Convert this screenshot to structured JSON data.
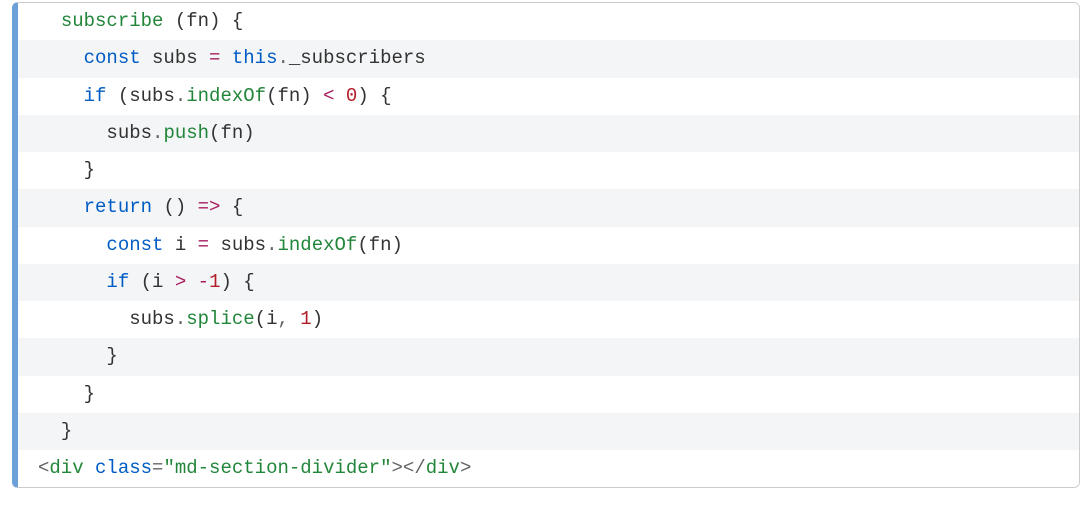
{
  "code": {
    "lines": [
      [
        {
          "cls": "tok-plain",
          "text": "  "
        },
        {
          "cls": "tok-function",
          "text": "subscribe"
        },
        {
          "cls": "tok-plain",
          "text": " "
        },
        {
          "cls": "tok-paren",
          "text": "("
        },
        {
          "cls": "tok-plain",
          "text": "fn"
        },
        {
          "cls": "tok-paren",
          "text": ")"
        },
        {
          "cls": "tok-plain",
          "text": " "
        },
        {
          "cls": "tok-paren",
          "text": "{"
        }
      ],
      [
        {
          "cls": "tok-plain",
          "text": "    "
        },
        {
          "cls": "tok-keyword",
          "text": "const"
        },
        {
          "cls": "tok-plain",
          "text": " subs "
        },
        {
          "cls": "tok-operator",
          "text": "="
        },
        {
          "cls": "tok-plain",
          "text": " "
        },
        {
          "cls": "tok-keyword",
          "text": "this"
        },
        {
          "cls": "tok-punct",
          "text": "."
        },
        {
          "cls": "tok-prop",
          "text": "_subscribers"
        }
      ],
      [
        {
          "cls": "tok-plain",
          "text": "    "
        },
        {
          "cls": "tok-keyword",
          "text": "if"
        },
        {
          "cls": "tok-plain",
          "text": " "
        },
        {
          "cls": "tok-paren",
          "text": "("
        },
        {
          "cls": "tok-plain",
          "text": "subs"
        },
        {
          "cls": "tok-punct",
          "text": "."
        },
        {
          "cls": "tok-function",
          "text": "indexOf"
        },
        {
          "cls": "tok-paren",
          "text": "("
        },
        {
          "cls": "tok-plain",
          "text": "fn"
        },
        {
          "cls": "tok-paren",
          "text": ")"
        },
        {
          "cls": "tok-plain",
          "text": " "
        },
        {
          "cls": "tok-operator",
          "text": "<"
        },
        {
          "cls": "tok-plain",
          "text": " "
        },
        {
          "cls": "tok-number",
          "text": "0"
        },
        {
          "cls": "tok-paren",
          "text": ")"
        },
        {
          "cls": "tok-plain",
          "text": " "
        },
        {
          "cls": "tok-paren",
          "text": "{"
        }
      ],
      [
        {
          "cls": "tok-plain",
          "text": "      subs"
        },
        {
          "cls": "tok-punct",
          "text": "."
        },
        {
          "cls": "tok-function",
          "text": "push"
        },
        {
          "cls": "tok-paren",
          "text": "("
        },
        {
          "cls": "tok-plain",
          "text": "fn"
        },
        {
          "cls": "tok-paren",
          "text": ")"
        }
      ],
      [
        {
          "cls": "tok-plain",
          "text": "    "
        },
        {
          "cls": "tok-paren",
          "text": "}"
        }
      ],
      [
        {
          "cls": "tok-plain",
          "text": "    "
        },
        {
          "cls": "tok-keyword",
          "text": "return"
        },
        {
          "cls": "tok-plain",
          "text": " "
        },
        {
          "cls": "tok-paren",
          "text": "("
        },
        {
          "cls": "tok-paren",
          "text": ")"
        },
        {
          "cls": "tok-plain",
          "text": " "
        },
        {
          "cls": "tok-operator",
          "text": "=>"
        },
        {
          "cls": "tok-plain",
          "text": " "
        },
        {
          "cls": "tok-paren",
          "text": "{"
        }
      ],
      [
        {
          "cls": "tok-plain",
          "text": "      "
        },
        {
          "cls": "tok-keyword",
          "text": "const"
        },
        {
          "cls": "tok-plain",
          "text": " i "
        },
        {
          "cls": "tok-operator",
          "text": "="
        },
        {
          "cls": "tok-plain",
          "text": " subs"
        },
        {
          "cls": "tok-punct",
          "text": "."
        },
        {
          "cls": "tok-function",
          "text": "indexOf"
        },
        {
          "cls": "tok-paren",
          "text": "("
        },
        {
          "cls": "tok-plain",
          "text": "fn"
        },
        {
          "cls": "tok-paren",
          "text": ")"
        }
      ],
      [
        {
          "cls": "tok-plain",
          "text": "      "
        },
        {
          "cls": "tok-keyword",
          "text": "if"
        },
        {
          "cls": "tok-plain",
          "text": " "
        },
        {
          "cls": "tok-paren",
          "text": "("
        },
        {
          "cls": "tok-plain",
          "text": "i "
        },
        {
          "cls": "tok-operator",
          "text": ">"
        },
        {
          "cls": "tok-plain",
          "text": " "
        },
        {
          "cls": "tok-operator",
          "text": "-"
        },
        {
          "cls": "tok-number",
          "text": "1"
        },
        {
          "cls": "tok-paren",
          "text": ")"
        },
        {
          "cls": "tok-plain",
          "text": " "
        },
        {
          "cls": "tok-paren",
          "text": "{"
        }
      ],
      [
        {
          "cls": "tok-plain",
          "text": "        subs"
        },
        {
          "cls": "tok-punct",
          "text": "."
        },
        {
          "cls": "tok-function",
          "text": "splice"
        },
        {
          "cls": "tok-paren",
          "text": "("
        },
        {
          "cls": "tok-plain",
          "text": "i"
        },
        {
          "cls": "tok-punct",
          "text": ","
        },
        {
          "cls": "tok-plain",
          "text": " "
        },
        {
          "cls": "tok-number",
          "text": "1"
        },
        {
          "cls": "tok-paren",
          "text": ")"
        }
      ],
      [
        {
          "cls": "tok-plain",
          "text": "      "
        },
        {
          "cls": "tok-paren",
          "text": "}"
        }
      ],
      [
        {
          "cls": "tok-plain",
          "text": "    "
        },
        {
          "cls": "tok-paren",
          "text": "}"
        }
      ],
      [
        {
          "cls": "tok-plain",
          "text": "  "
        },
        {
          "cls": "tok-paren",
          "text": "}"
        }
      ],
      [
        {
          "cls": "tok-punct",
          "text": "<"
        },
        {
          "cls": "tok-tag",
          "text": "div"
        },
        {
          "cls": "tok-plain",
          "text": " "
        },
        {
          "cls": "tok-attr",
          "text": "class"
        },
        {
          "cls": "tok-punct",
          "text": "="
        },
        {
          "cls": "tok-string",
          "text": "\"md-section-divider\""
        },
        {
          "cls": "tok-punct",
          "text": ">"
        },
        {
          "cls": "tok-punct",
          "text": "<"
        },
        {
          "cls": "tok-punct",
          "text": "/"
        },
        {
          "cls": "tok-tag",
          "text": "div"
        },
        {
          "cls": "tok-punct",
          "text": ">"
        }
      ]
    ]
  }
}
